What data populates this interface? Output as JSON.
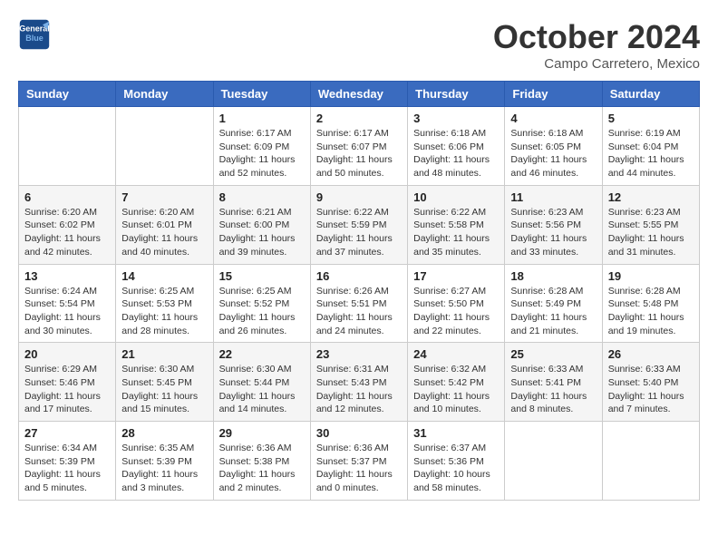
{
  "header": {
    "logo_line1": "General",
    "logo_line2": "Blue",
    "month": "October 2024",
    "location": "Campo Carretero, Mexico"
  },
  "weekdays": [
    "Sunday",
    "Monday",
    "Tuesday",
    "Wednesday",
    "Thursday",
    "Friday",
    "Saturday"
  ],
  "weeks": [
    [
      {
        "day": "",
        "sunrise": "",
        "sunset": "",
        "daylight": ""
      },
      {
        "day": "",
        "sunrise": "",
        "sunset": "",
        "daylight": ""
      },
      {
        "day": "1",
        "sunrise": "Sunrise: 6:17 AM",
        "sunset": "Sunset: 6:09 PM",
        "daylight": "Daylight: 11 hours and 52 minutes."
      },
      {
        "day": "2",
        "sunrise": "Sunrise: 6:17 AM",
        "sunset": "Sunset: 6:07 PM",
        "daylight": "Daylight: 11 hours and 50 minutes."
      },
      {
        "day": "3",
        "sunrise": "Sunrise: 6:18 AM",
        "sunset": "Sunset: 6:06 PM",
        "daylight": "Daylight: 11 hours and 48 minutes."
      },
      {
        "day": "4",
        "sunrise": "Sunrise: 6:18 AM",
        "sunset": "Sunset: 6:05 PM",
        "daylight": "Daylight: 11 hours and 46 minutes."
      },
      {
        "day": "5",
        "sunrise": "Sunrise: 6:19 AM",
        "sunset": "Sunset: 6:04 PM",
        "daylight": "Daylight: 11 hours and 44 minutes."
      }
    ],
    [
      {
        "day": "6",
        "sunrise": "Sunrise: 6:20 AM",
        "sunset": "Sunset: 6:02 PM",
        "daylight": "Daylight: 11 hours and 42 minutes."
      },
      {
        "day": "7",
        "sunrise": "Sunrise: 6:20 AM",
        "sunset": "Sunset: 6:01 PM",
        "daylight": "Daylight: 11 hours and 40 minutes."
      },
      {
        "day": "8",
        "sunrise": "Sunrise: 6:21 AM",
        "sunset": "Sunset: 6:00 PM",
        "daylight": "Daylight: 11 hours and 39 minutes."
      },
      {
        "day": "9",
        "sunrise": "Sunrise: 6:22 AM",
        "sunset": "Sunset: 5:59 PM",
        "daylight": "Daylight: 11 hours and 37 minutes."
      },
      {
        "day": "10",
        "sunrise": "Sunrise: 6:22 AM",
        "sunset": "Sunset: 5:58 PM",
        "daylight": "Daylight: 11 hours and 35 minutes."
      },
      {
        "day": "11",
        "sunrise": "Sunrise: 6:23 AM",
        "sunset": "Sunset: 5:56 PM",
        "daylight": "Daylight: 11 hours and 33 minutes."
      },
      {
        "day": "12",
        "sunrise": "Sunrise: 6:23 AM",
        "sunset": "Sunset: 5:55 PM",
        "daylight": "Daylight: 11 hours and 31 minutes."
      }
    ],
    [
      {
        "day": "13",
        "sunrise": "Sunrise: 6:24 AM",
        "sunset": "Sunset: 5:54 PM",
        "daylight": "Daylight: 11 hours and 30 minutes."
      },
      {
        "day": "14",
        "sunrise": "Sunrise: 6:25 AM",
        "sunset": "Sunset: 5:53 PM",
        "daylight": "Daylight: 11 hours and 28 minutes."
      },
      {
        "day": "15",
        "sunrise": "Sunrise: 6:25 AM",
        "sunset": "Sunset: 5:52 PM",
        "daylight": "Daylight: 11 hours and 26 minutes."
      },
      {
        "day": "16",
        "sunrise": "Sunrise: 6:26 AM",
        "sunset": "Sunset: 5:51 PM",
        "daylight": "Daylight: 11 hours and 24 minutes."
      },
      {
        "day": "17",
        "sunrise": "Sunrise: 6:27 AM",
        "sunset": "Sunset: 5:50 PM",
        "daylight": "Daylight: 11 hours and 22 minutes."
      },
      {
        "day": "18",
        "sunrise": "Sunrise: 6:28 AM",
        "sunset": "Sunset: 5:49 PM",
        "daylight": "Daylight: 11 hours and 21 minutes."
      },
      {
        "day": "19",
        "sunrise": "Sunrise: 6:28 AM",
        "sunset": "Sunset: 5:48 PM",
        "daylight": "Daylight: 11 hours and 19 minutes."
      }
    ],
    [
      {
        "day": "20",
        "sunrise": "Sunrise: 6:29 AM",
        "sunset": "Sunset: 5:46 PM",
        "daylight": "Daylight: 11 hours and 17 minutes."
      },
      {
        "day": "21",
        "sunrise": "Sunrise: 6:30 AM",
        "sunset": "Sunset: 5:45 PM",
        "daylight": "Daylight: 11 hours and 15 minutes."
      },
      {
        "day": "22",
        "sunrise": "Sunrise: 6:30 AM",
        "sunset": "Sunset: 5:44 PM",
        "daylight": "Daylight: 11 hours and 14 minutes."
      },
      {
        "day": "23",
        "sunrise": "Sunrise: 6:31 AM",
        "sunset": "Sunset: 5:43 PM",
        "daylight": "Daylight: 11 hours and 12 minutes."
      },
      {
        "day": "24",
        "sunrise": "Sunrise: 6:32 AM",
        "sunset": "Sunset: 5:42 PM",
        "daylight": "Daylight: 11 hours and 10 minutes."
      },
      {
        "day": "25",
        "sunrise": "Sunrise: 6:33 AM",
        "sunset": "Sunset: 5:41 PM",
        "daylight": "Daylight: 11 hours and 8 minutes."
      },
      {
        "day": "26",
        "sunrise": "Sunrise: 6:33 AM",
        "sunset": "Sunset: 5:40 PM",
        "daylight": "Daylight: 11 hours and 7 minutes."
      }
    ],
    [
      {
        "day": "27",
        "sunrise": "Sunrise: 6:34 AM",
        "sunset": "Sunset: 5:39 PM",
        "daylight": "Daylight: 11 hours and 5 minutes."
      },
      {
        "day": "28",
        "sunrise": "Sunrise: 6:35 AM",
        "sunset": "Sunset: 5:39 PM",
        "daylight": "Daylight: 11 hours and 3 minutes."
      },
      {
        "day": "29",
        "sunrise": "Sunrise: 6:36 AM",
        "sunset": "Sunset: 5:38 PM",
        "daylight": "Daylight: 11 hours and 2 minutes."
      },
      {
        "day": "30",
        "sunrise": "Sunrise: 6:36 AM",
        "sunset": "Sunset: 5:37 PM",
        "daylight": "Daylight: 11 hours and 0 minutes."
      },
      {
        "day": "31",
        "sunrise": "Sunrise: 6:37 AM",
        "sunset": "Sunset: 5:36 PM",
        "daylight": "Daylight: 10 hours and 58 minutes."
      },
      {
        "day": "",
        "sunrise": "",
        "sunset": "",
        "daylight": ""
      },
      {
        "day": "",
        "sunrise": "",
        "sunset": "",
        "daylight": ""
      }
    ]
  ]
}
